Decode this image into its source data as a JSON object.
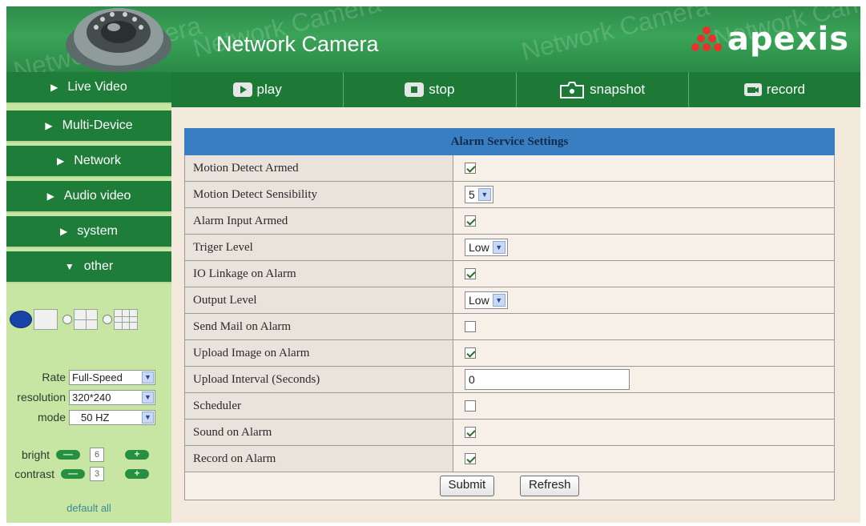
{
  "header": {
    "title": "Network Camera",
    "brand": "apexis",
    "watermark": "Network Camera"
  },
  "toolbar": [
    {
      "label": "play",
      "icon": "play-icon"
    },
    {
      "label": "stop",
      "icon": "stop-icon"
    },
    {
      "label": "snapshot",
      "icon": "camera-icon"
    },
    {
      "label": "record",
      "icon": "video-camera-icon"
    }
  ],
  "sidebar": {
    "nav": [
      {
        "label": "Live Video",
        "arrow": "▶"
      },
      {
        "label": "Multi-Device",
        "arrow": "▶"
      },
      {
        "label": "Network",
        "arrow": "▶"
      },
      {
        "label": "Audio video",
        "arrow": "▶"
      },
      {
        "label": "system",
        "arrow": "▶"
      },
      {
        "label": "other",
        "arrow": "▼"
      }
    ],
    "view_layout": [
      "single",
      "quad",
      "nine"
    ],
    "selected_layout": "single",
    "rate_label": "Rate",
    "rate_value": "Full-Speed",
    "resolution_label": "resolution",
    "resolution_value": "320*240",
    "mode_label": "mode",
    "mode_value": "50 HZ",
    "bright_label": "bright",
    "bright_value": "6",
    "contrast_label": "contrast",
    "contrast_value": "3",
    "minus_glyph": "—",
    "plus_glyph": "+",
    "default_all": "default all"
  },
  "settings": {
    "caption": "Alarm Service Settings",
    "rows": [
      {
        "label": "Motion Detect Armed",
        "type": "checkbox",
        "checked": true
      },
      {
        "label": "Motion Detect Sensibility",
        "type": "select",
        "value": "5"
      },
      {
        "label": "Alarm Input Armed",
        "type": "checkbox",
        "checked": true
      },
      {
        "label": "Triger Level",
        "type": "select",
        "value": "Low"
      },
      {
        "label": "IO Linkage on Alarm",
        "type": "checkbox",
        "checked": true
      },
      {
        "label": "Output Level",
        "type": "select",
        "value": "Low"
      },
      {
        "label": "Send Mail on Alarm",
        "type": "checkbox",
        "checked": false
      },
      {
        "label": "Upload Image on Alarm",
        "type": "checkbox",
        "checked": true
      },
      {
        "label": "Upload Interval (Seconds)",
        "type": "text",
        "value": "0"
      },
      {
        "label": "Scheduler",
        "type": "checkbox",
        "checked": false
      },
      {
        "label": "Sound on Alarm",
        "type": "checkbox",
        "checked": true
      },
      {
        "label": "Record on Alarm",
        "type": "checkbox",
        "checked": true
      }
    ],
    "submit_label": "Submit",
    "refresh_label": "Refresh"
  },
  "colors": {
    "header_green": "#3aa458",
    "nav_green": "#1f7d3a",
    "sidebar_bg": "#c7e6a4",
    "caption_blue": "#3a7ec2",
    "panel_bg": "#f3e9dd",
    "brand_red": "#e8322b"
  }
}
